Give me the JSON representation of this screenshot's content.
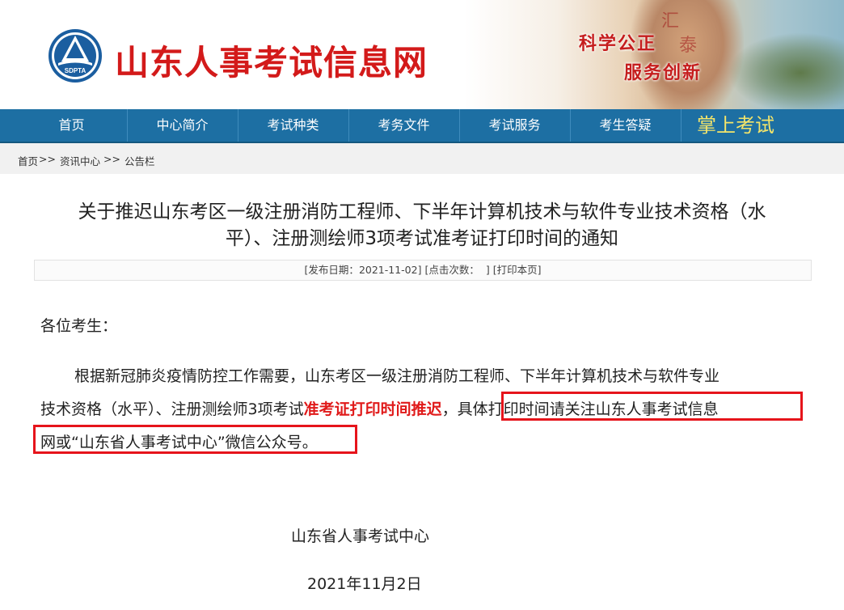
{
  "header": {
    "logo_text": "SDPTA",
    "site_title": "山东人事考试信息网",
    "slogan_line1": "科学公正",
    "slogan_line2": "服务创新"
  },
  "nav": {
    "items": [
      {
        "label": "首页"
      },
      {
        "label": "中心简介"
      },
      {
        "label": "考试种类"
      },
      {
        "label": "考务文件"
      },
      {
        "label": "考试服务"
      },
      {
        "label": "考生答疑"
      }
    ],
    "mobile_label": "掌上考试"
  },
  "breadcrumb": {
    "home": "首页",
    "sep1": ">>",
    "section": "资讯中心",
    "sep2": ">>",
    "current": "公告栏"
  },
  "article": {
    "title_line1": "关于推迟山东考区一级注册消防工程师、下半年计算机技术与软件专业技术资格（水",
    "title_line2": "平）、注册测绘师3项考试准考证打印时间的通知",
    "meta": {
      "publish_label": "[发布日期：",
      "publish_date": "2021-11-02",
      "publish_close": "]",
      "clicks_label": "[点击次数：",
      "clicks_value": "",
      "clicks_close": "]",
      "print_link": "[打印本页]"
    },
    "greeting": "各位考生：",
    "body": {
      "line1": "根据新冠肺炎疫情防控工作需要，山东考区一级注册消防工程师、下半年计算机技术与软件专业",
      "line2_a": "技术资格（水平）、注册测绘师3项考试",
      "line2_red": "准考证打印时间推迟",
      "line2_comma": "，",
      "line2_b": "具体打印时间请关注山东人事考试信息",
      "line3": "网或“山东省人事考试中心”微信公众号。"
    },
    "signature_org": "山东省人事考试中心",
    "signature_date": "2021年11月2日"
  },
  "colors": {
    "nav_bg": "#1d6fa3",
    "title_red": "#d31a1a",
    "highlight_box": "#e6141b",
    "mobile_label": "#f4e56a"
  }
}
